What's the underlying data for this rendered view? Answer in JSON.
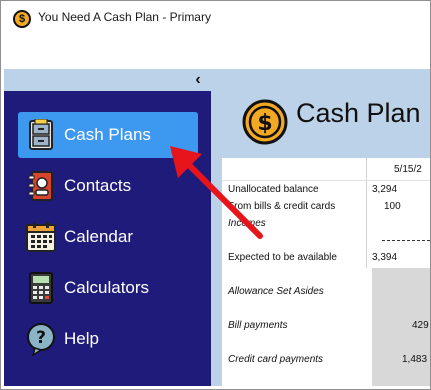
{
  "window": {
    "title": "You Need A Cash Plan - Primary"
  },
  "sidebar": {
    "collapse_glyph": "‹",
    "items": [
      {
        "label": "Cash Plans",
        "icon": "file-cabinet-icon",
        "active": true
      },
      {
        "label": "Contacts",
        "icon": "address-book-icon",
        "active": false
      },
      {
        "label": "Calendar",
        "icon": "calendar-icon",
        "active": false
      },
      {
        "label": "Calculators",
        "icon": "calculator-icon",
        "active": false
      },
      {
        "label": "Help",
        "icon": "help-icon",
        "active": false
      }
    ]
  },
  "main": {
    "title": "Cash Plan",
    "icon": "dollar-coin-icon",
    "date_header": "5/15/2",
    "rows": [
      {
        "label": "Unallocated balance",
        "value": "3,294"
      },
      {
        "label": "From bills & credit cards",
        "value": "100"
      },
      {
        "label": "Incomes",
        "value": ""
      },
      {
        "label": "Expected to be available",
        "value": "3,394"
      },
      {
        "label": "Allowance Set Asides",
        "value": ""
      },
      {
        "label": "Bill payments",
        "value": "429"
      },
      {
        "label": "Credit card payments",
        "value": "1,483"
      }
    ]
  },
  "colors": {
    "sidebar_bg": "#1e1b7b",
    "active_item": "#3d98f0",
    "main_bg": "#bcd2e8",
    "arrow": "#e8141c",
    "coin": "#f4a923"
  }
}
